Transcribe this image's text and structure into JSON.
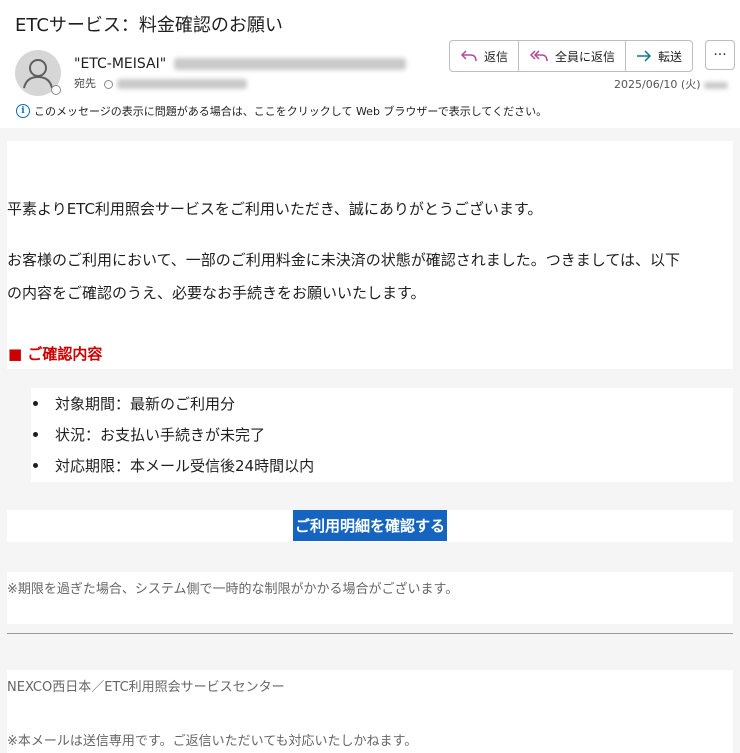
{
  "header": {
    "subject": "ETCサービス：料金確認のお願い",
    "sender_name": "\"ETC-MEISAI\"",
    "to_label": "宛先",
    "date": "2025/06/10 (火)",
    "info_text": "このメッセージの表示に問題がある場合は、ここをクリックして Web ブラウザーで表示してください。"
  },
  "actions": {
    "reply": "返信",
    "reply_all": "全員に返信",
    "forward": "転送",
    "more": "···"
  },
  "colors": {
    "reply_icon": "#b4489b",
    "forward_icon": "#0f7b8c",
    "heading": "#cc0000",
    "cta": "#1565c0",
    "info": "#0f6cbd"
  },
  "message": {
    "greeting": "平素よりETC利用照会サービスをご利用いただき、誠にありがとうございます。",
    "body_line1": "お客様のご利用において、一部のご利用料金に未決済の状態が確認されました。つきましては、以下",
    "body_line2": "の内容をご確認のうえ、必要なお手続きをお願いいたします。",
    "section_heading": "■ ご確認内容",
    "items": [
      "対象期間：最新のご利用分",
      "状況：お支払い手続きが未完了",
      "対応期限：本メール受信後24時間以内"
    ],
    "cta_label": "ご利用明細を確認する",
    "notice": "※期限を過ぎた場合、システム側で一時的な制限がかかる場合がございます。",
    "signature": "NEXCO西日本／ETC利用照会サービスセンター",
    "footer_note": "※本メールは送信専用です。ご返信いただいても対応いたしかねます。"
  }
}
